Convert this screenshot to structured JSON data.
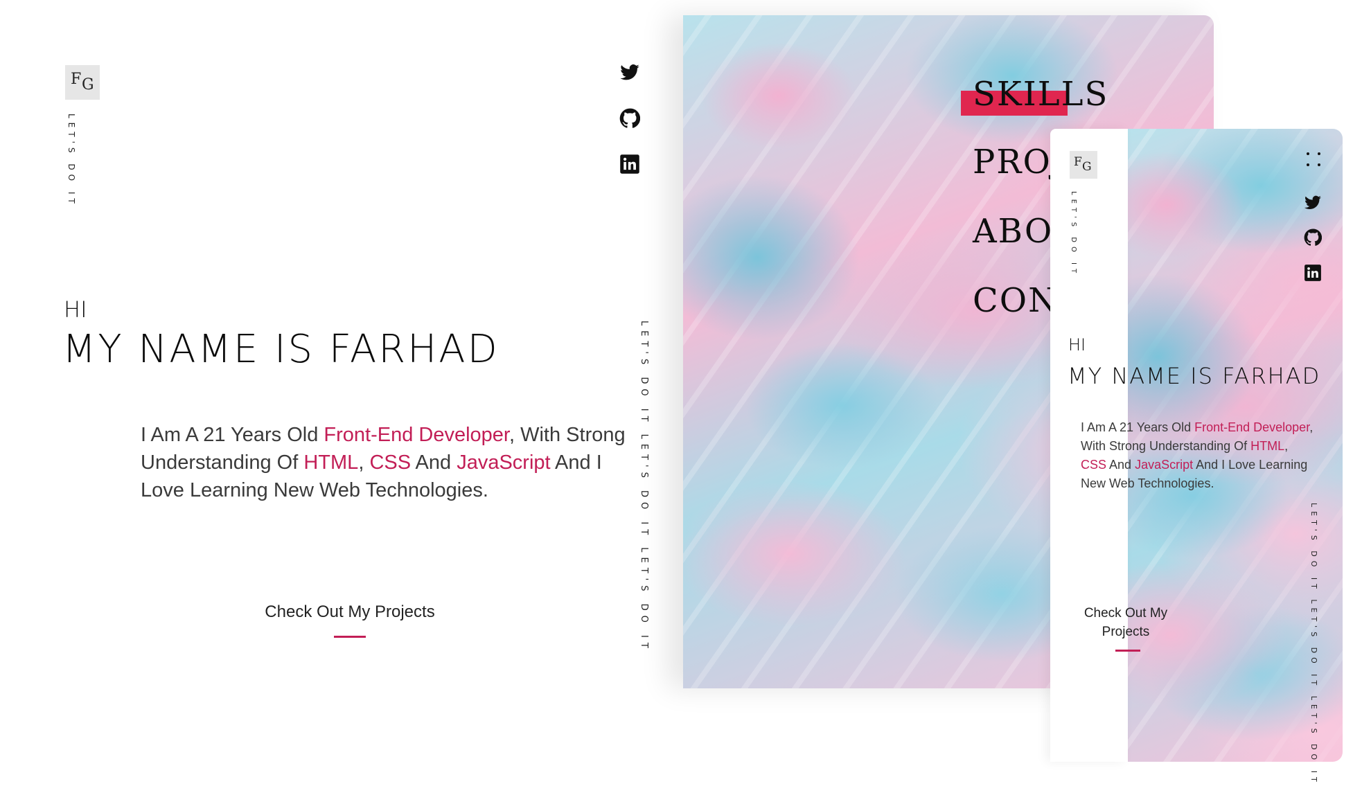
{
  "colors": {
    "accent": "#c21e56",
    "menu_highlight": "#e0264f",
    "text": "#111111",
    "logo_bg": "#e6e6e6"
  },
  "brand": {
    "logo_first": "F",
    "logo_second": "G",
    "tagline": "LET'S DO IT"
  },
  "hero": {
    "greeting": "HI",
    "name": "MY NAME IS FARHAD",
    "intro": {
      "p1": "I Am A 21 Years Old ",
      "role": "Front-End Developer",
      "p2": ", With Strong Understanding Of ",
      "html": "HTML",
      "sep": ", ",
      "css": "CSS",
      "and": " And ",
      "js": "JavaScript",
      "p3": " And I Love Learning New Web Technologies."
    },
    "cta": "Check Out My Projects"
  },
  "side_marquee": "LET'S DO IT LET'S DO IT LET'S DO IT",
  "social": [
    "twitter-icon",
    "github-icon",
    "linkedin-icon"
  ],
  "menu": {
    "items": [
      "SKILLS",
      "PROJ",
      "ABOU",
      "CONT"
    ]
  },
  "phone": {
    "greeting": "HI",
    "name": "MY NAME IS FARHAD",
    "cta_line1": "Check Out My",
    "cta_line2": "Projects",
    "marquee": "LET'S DO IT LET'S DO IT LET'S DO IT"
  }
}
